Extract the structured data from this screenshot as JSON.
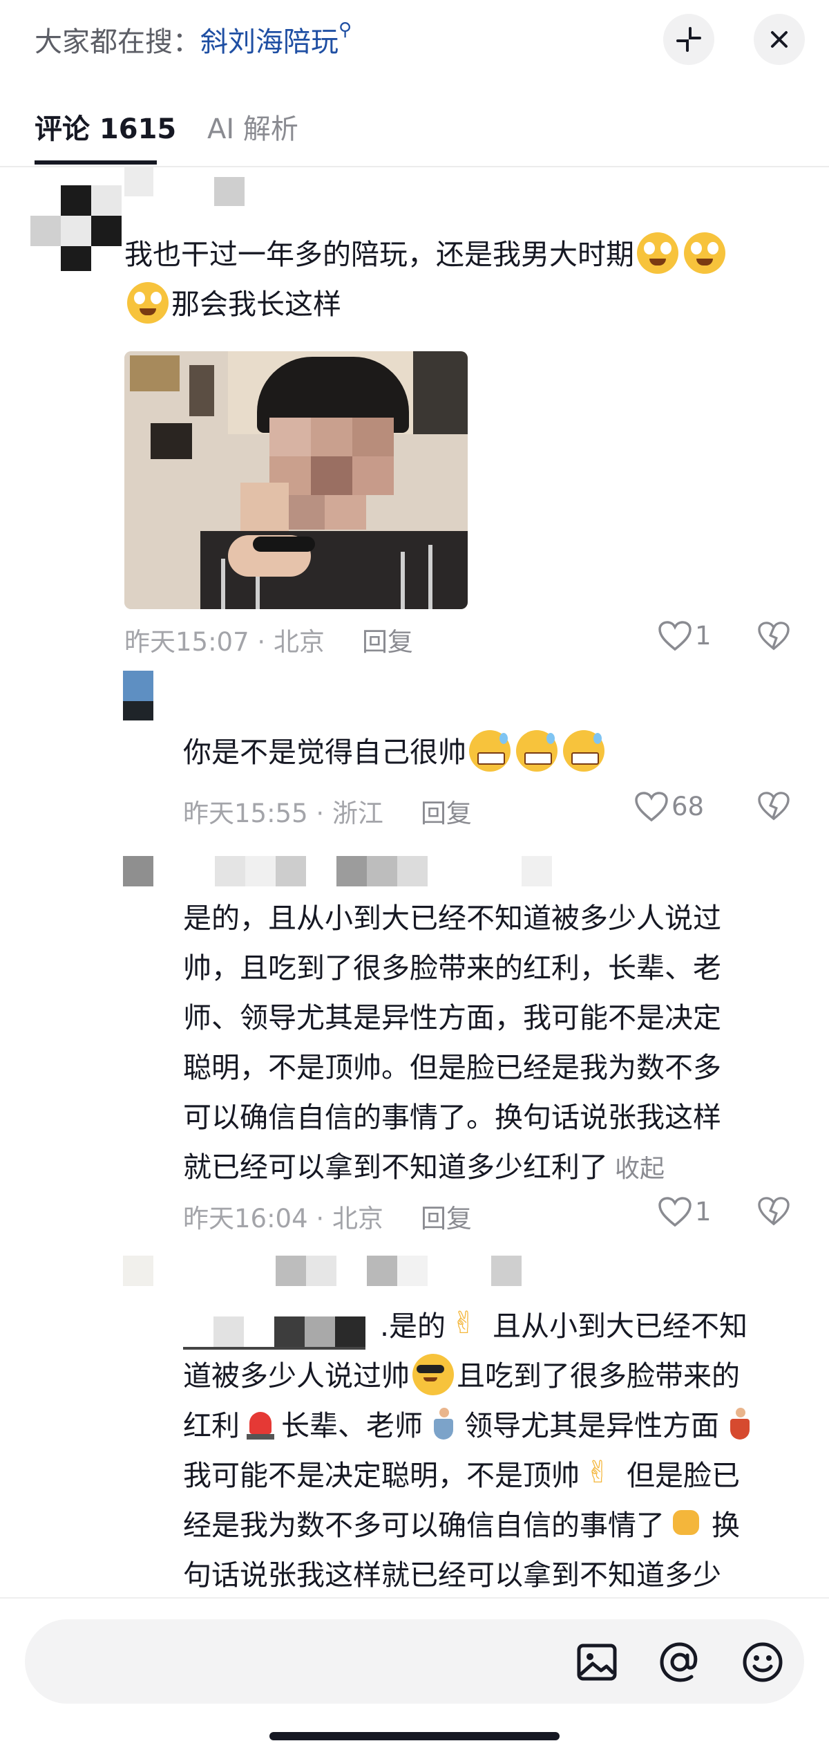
{
  "header": {
    "search_prefix": "大家都在搜：",
    "search_keyword": "斜刘海陪玩",
    "icons": {
      "search": "search-icon",
      "minimize": "collapse-icon",
      "close": "close-icon"
    }
  },
  "tabs": [
    {
      "label": "评论 1615",
      "active": true
    },
    {
      "label": "AI 解析",
      "active": false
    }
  ],
  "comments": [
    {
      "text_a": "我也干过一年多的陪玩，还是我男大时期",
      "text_b": "那会我长这样",
      "emojis": [
        "crying-face",
        "crying-face",
        "crying-face"
      ],
      "has_photo": true,
      "time": "昨天15:07",
      "location": "北京",
      "reply": "回复",
      "likes": "1"
    },
    {
      "text": "你是不是觉得自己很帅",
      "emojis": [
        "grin-sweat",
        "grin-sweat",
        "grin-sweat"
      ],
      "time": "昨天15:55",
      "location": "浙江",
      "reply": "回复",
      "likes": "68"
    },
    {
      "lines": [
        "是的，且从小到大已经不知道被多少人说过",
        "帅，且吃到了很多脸带来的红利，长辈、老",
        "师、领导尤其是异性方面，我可能不是决定",
        "聪明，不是顶帅。但是脸已经是我为数不多",
        "可以确信自信的事情了。换句话说张我这样",
        "就已经可以拿到不知道多少红利了"
      ],
      "collapse": "收起",
      "time": "昨天16:04",
      "location": "北京",
      "reply": "回复",
      "likes": "1"
    },
    {
      "lines": [
        ".是的",
        "且从小到大已经不知",
        "道被多少人说过帅",
        "且吃到了很多脸带来的",
        "红利",
        "长辈、老师",
        "领导尤其是异性方面",
        "我可能不是决定聪明，不是顶帅",
        "但是脸已",
        "经是我为数不多可以确信自信的事情了",
        "换",
        "句话说张我这样就已经可以拿到不知道多少"
      ]
    }
  ],
  "input": {
    "placeholder": ""
  },
  "colors": {
    "accent": "#1f4fa3",
    "text": "#161823",
    "muted": "#a3a4a9"
  }
}
